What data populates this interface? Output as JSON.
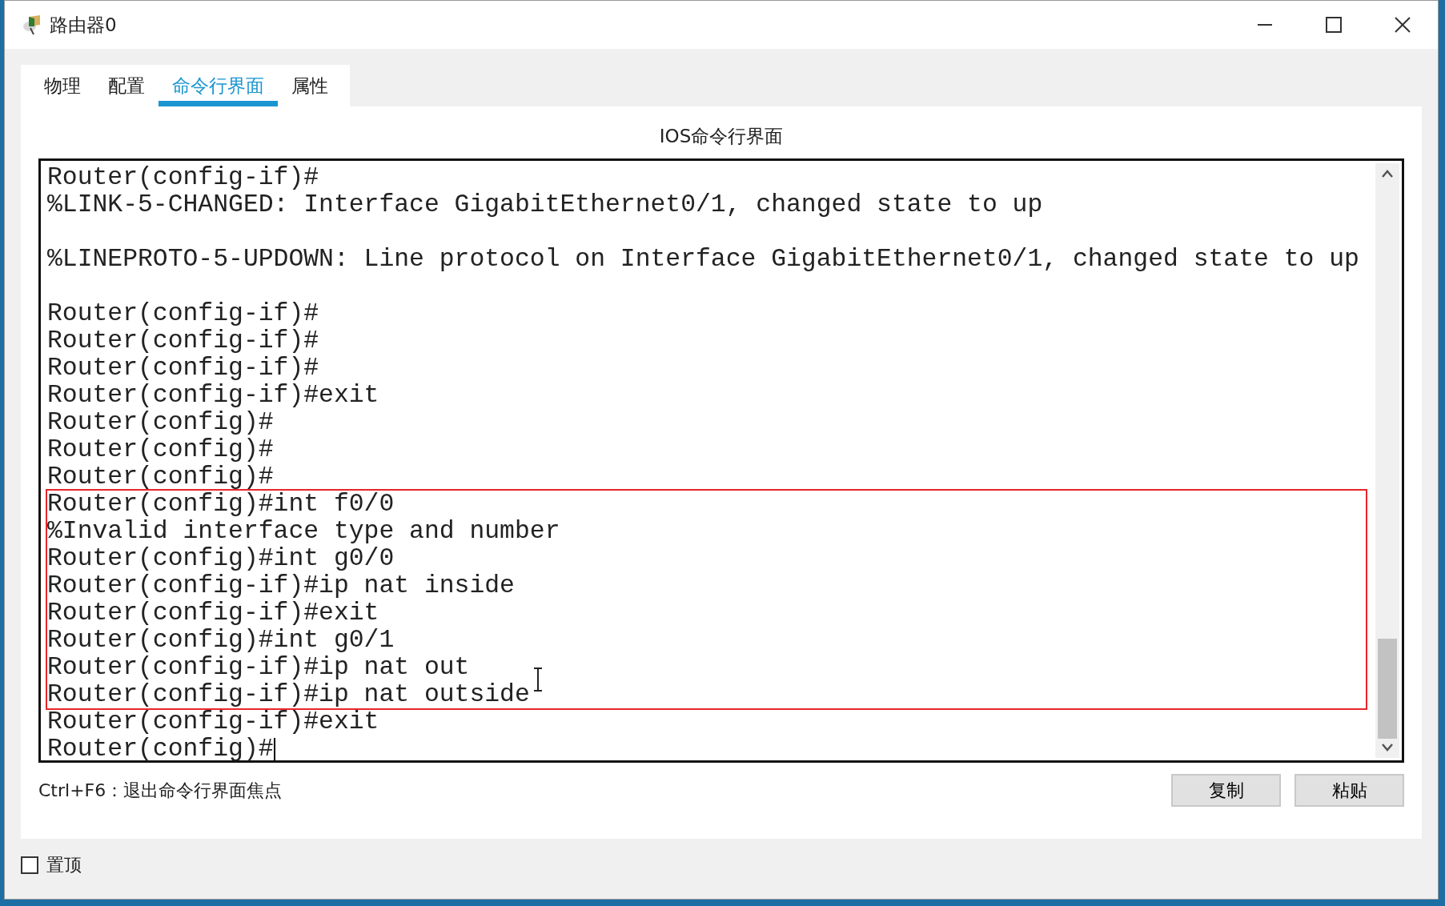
{
  "window": {
    "title": "路由器0"
  },
  "tabs": [
    {
      "label": "物理",
      "selected": false
    },
    {
      "label": "配置",
      "selected": false
    },
    {
      "label": "命令行界面",
      "selected": true
    },
    {
      "label": "属性",
      "selected": false
    }
  ],
  "panel_title": "IOS命令行界面",
  "terminal": {
    "cursor": true,
    "blocks": [
      {
        "highlighted": false,
        "lines": [
          {
            "kind": "text",
            "text": "Router(config-if)#"
          },
          {
            "kind": "text",
            "text": "%LINK-5-CHANGED: Interface GigabitEthernet0/1, changed state to up"
          },
          {
            "kind": "blank"
          },
          {
            "kind": "text",
            "text": "%LINEPROTO-5-UPDOWN: Line protocol on Interface GigabitEthernet0/1, changed state to up"
          },
          {
            "kind": "blank"
          },
          {
            "kind": "text",
            "text": "Router(config-if)#"
          },
          {
            "kind": "text",
            "text": "Router(config-if)#"
          },
          {
            "kind": "text",
            "text": "Router(config-if)#"
          },
          {
            "kind": "text",
            "text": "Router(config-if)#exit"
          },
          {
            "kind": "text",
            "text": "Router(config)#"
          },
          {
            "kind": "text",
            "text": "Router(config)#"
          },
          {
            "kind": "text",
            "text": "Router(config)#"
          }
        ]
      },
      {
        "highlighted": true,
        "lines": [
          {
            "kind": "text",
            "text": "Router(config)#int f0/0"
          },
          {
            "kind": "text",
            "text": "%Invalid interface type and number"
          },
          {
            "kind": "text",
            "text": "Router(config)#int g0/0"
          },
          {
            "kind": "text",
            "text": "Router(config-if)#ip nat inside"
          },
          {
            "kind": "text",
            "text": "Router(config-if)#exit"
          },
          {
            "kind": "text",
            "text": "Router(config)#int g0/1"
          },
          {
            "kind": "text",
            "text": "Router(config-if)#ip nat out"
          },
          {
            "kind": "text",
            "text": "Router(config-if)#ip nat outside"
          }
        ]
      },
      {
        "highlighted": false,
        "lines": [
          {
            "kind": "text",
            "text": "Router(config-if)#exit"
          },
          {
            "kind": "text",
            "text": "Router(config)#"
          }
        ]
      }
    ]
  },
  "hint": "Ctrl+F6：退出命令行界面焦点",
  "buttons": [
    "复制",
    "粘贴"
  ],
  "always_on_top": {
    "label": "置顶",
    "checked": false
  }
}
